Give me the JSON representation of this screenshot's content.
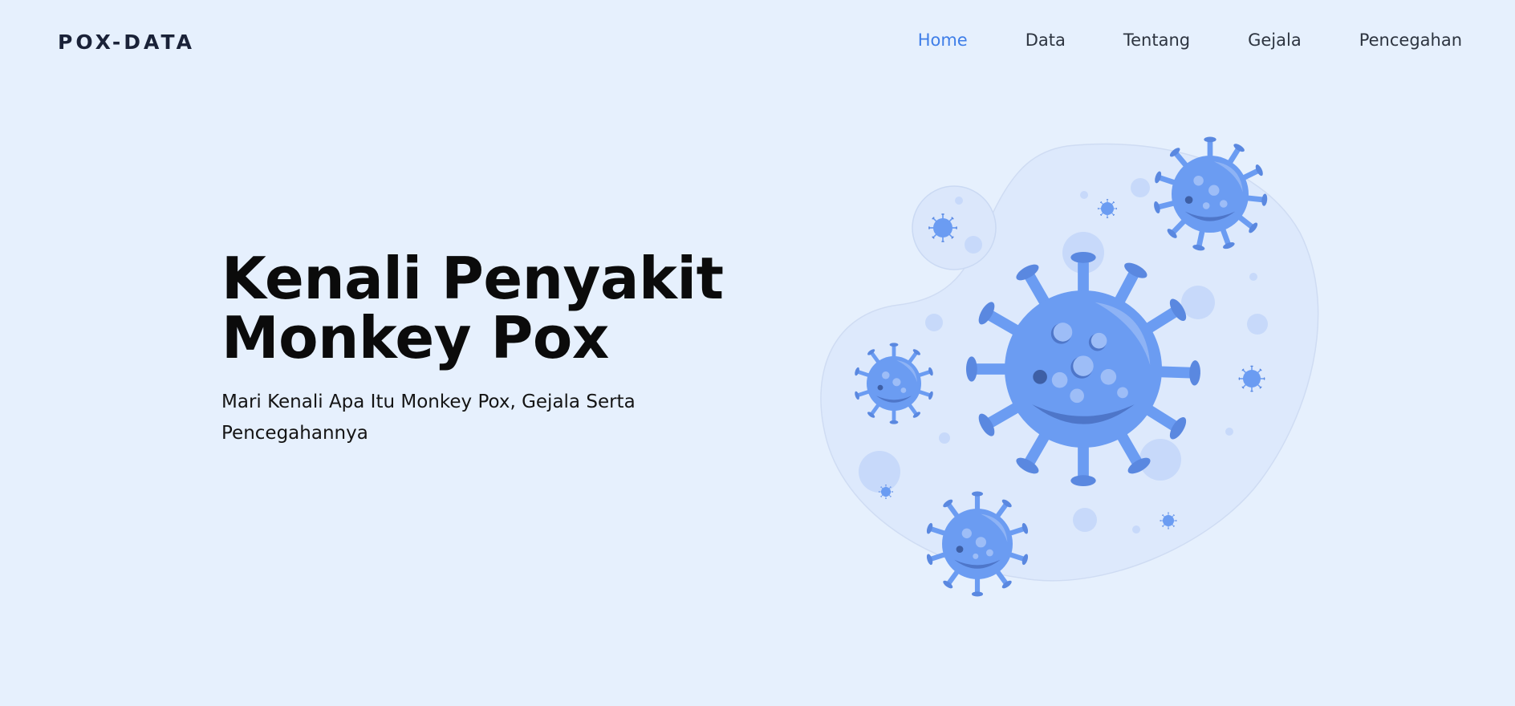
{
  "brand": "POX-DATA",
  "nav": {
    "items": [
      {
        "label": "Home",
        "active": true
      },
      {
        "label": "Data",
        "active": false
      },
      {
        "label": "Tentang",
        "active": false
      },
      {
        "label": "Gejala",
        "active": false
      },
      {
        "label": "Pencegahan",
        "active": false
      }
    ]
  },
  "hero": {
    "title_line1": "Kenali Penyakit",
    "title_line2": "Monkey Pox",
    "subtitle": "Mari Kenali Apa Itu Monkey Pox, Gejala Serta Pencegahannya"
  },
  "illustration": {
    "icon": "virus-illustration",
    "colors": {
      "background": "#e6f0fd",
      "accent": "#3f7ee8",
      "virus_body": "#6b9cf2",
      "virus_dark": "#4e76c9",
      "bubble": "#c7d9fa"
    }
  }
}
